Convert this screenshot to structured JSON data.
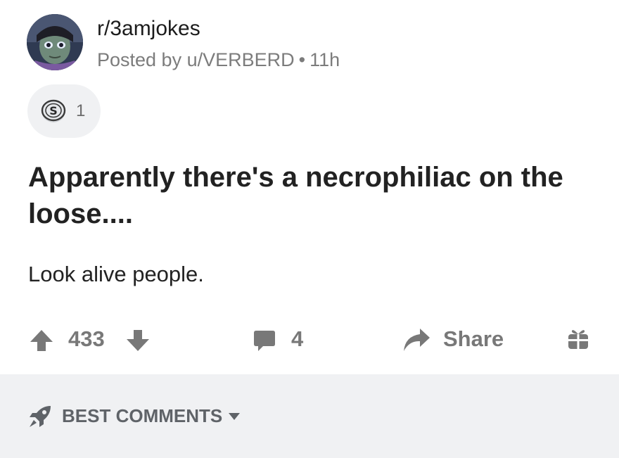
{
  "post": {
    "subreddit": "r/3amjokes",
    "posted_by": "Posted by u/VERBERD",
    "separator": "•",
    "time_ago": "11h",
    "award_count": "1",
    "title": "Apparently there's a necrophiliac on the loose....",
    "body": "Look alive people.",
    "icons": {
      "avatar": "avatar-image",
      "award": "silver-award-icon",
      "upvote": "upvote-arrow-icon",
      "downvote": "downvote-arrow-icon",
      "comment": "comment-bubble-icon",
      "share": "share-arrow-icon",
      "gift": "gift-icon"
    }
  },
  "actions": {
    "score": "433",
    "comment_count": "4",
    "share_label": "Share"
  },
  "comments": {
    "sort_label": "BEST COMMENTS",
    "sort_icon": "rocket-icon"
  },
  "colors": {
    "icon_gray": "#787878",
    "background_bar": "#f0f1f3",
    "text_dark": "#222222"
  }
}
